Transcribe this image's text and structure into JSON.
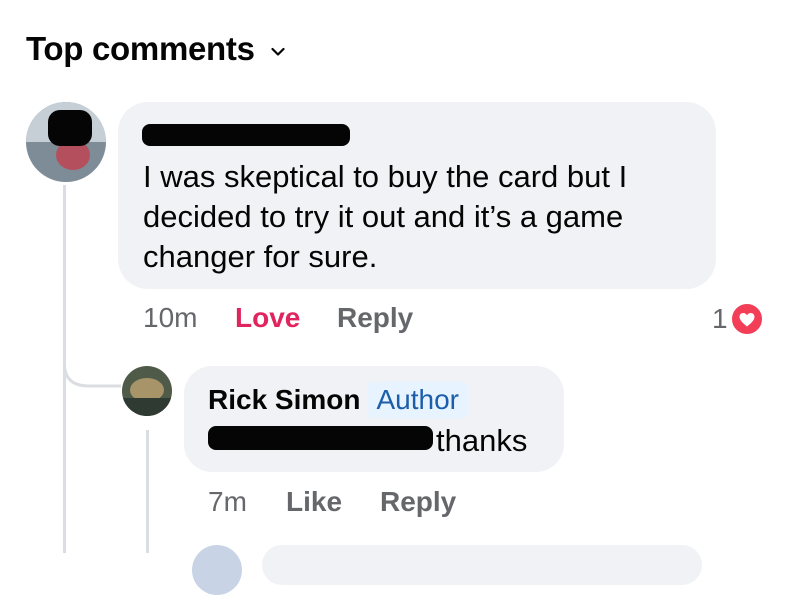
{
  "header": {
    "title": "Top comments"
  },
  "comments": [
    {
      "text_lines": [
        "I was skeptical to buy the card but I",
        "decided to try it out and it’s a game",
        "changer for sure."
      ],
      "time": "10m",
      "reaction_label": "Love",
      "reply_label": "Reply",
      "reaction_count": "1",
      "reaction_icon": "heart-icon"
    }
  ],
  "replies": [
    {
      "author": "Rick Simon",
      "badge": "Author",
      "text_suffix": "thanks",
      "time": "7m",
      "like_label": "Like",
      "reply_label": "Reply"
    }
  ],
  "colors": {
    "bubble": "#f0f2f5",
    "love": "#e0245e",
    "author_badge_bg": "#e7f3ff",
    "author_badge_text": "#1b5eaa",
    "muted": "#65676b"
  }
}
